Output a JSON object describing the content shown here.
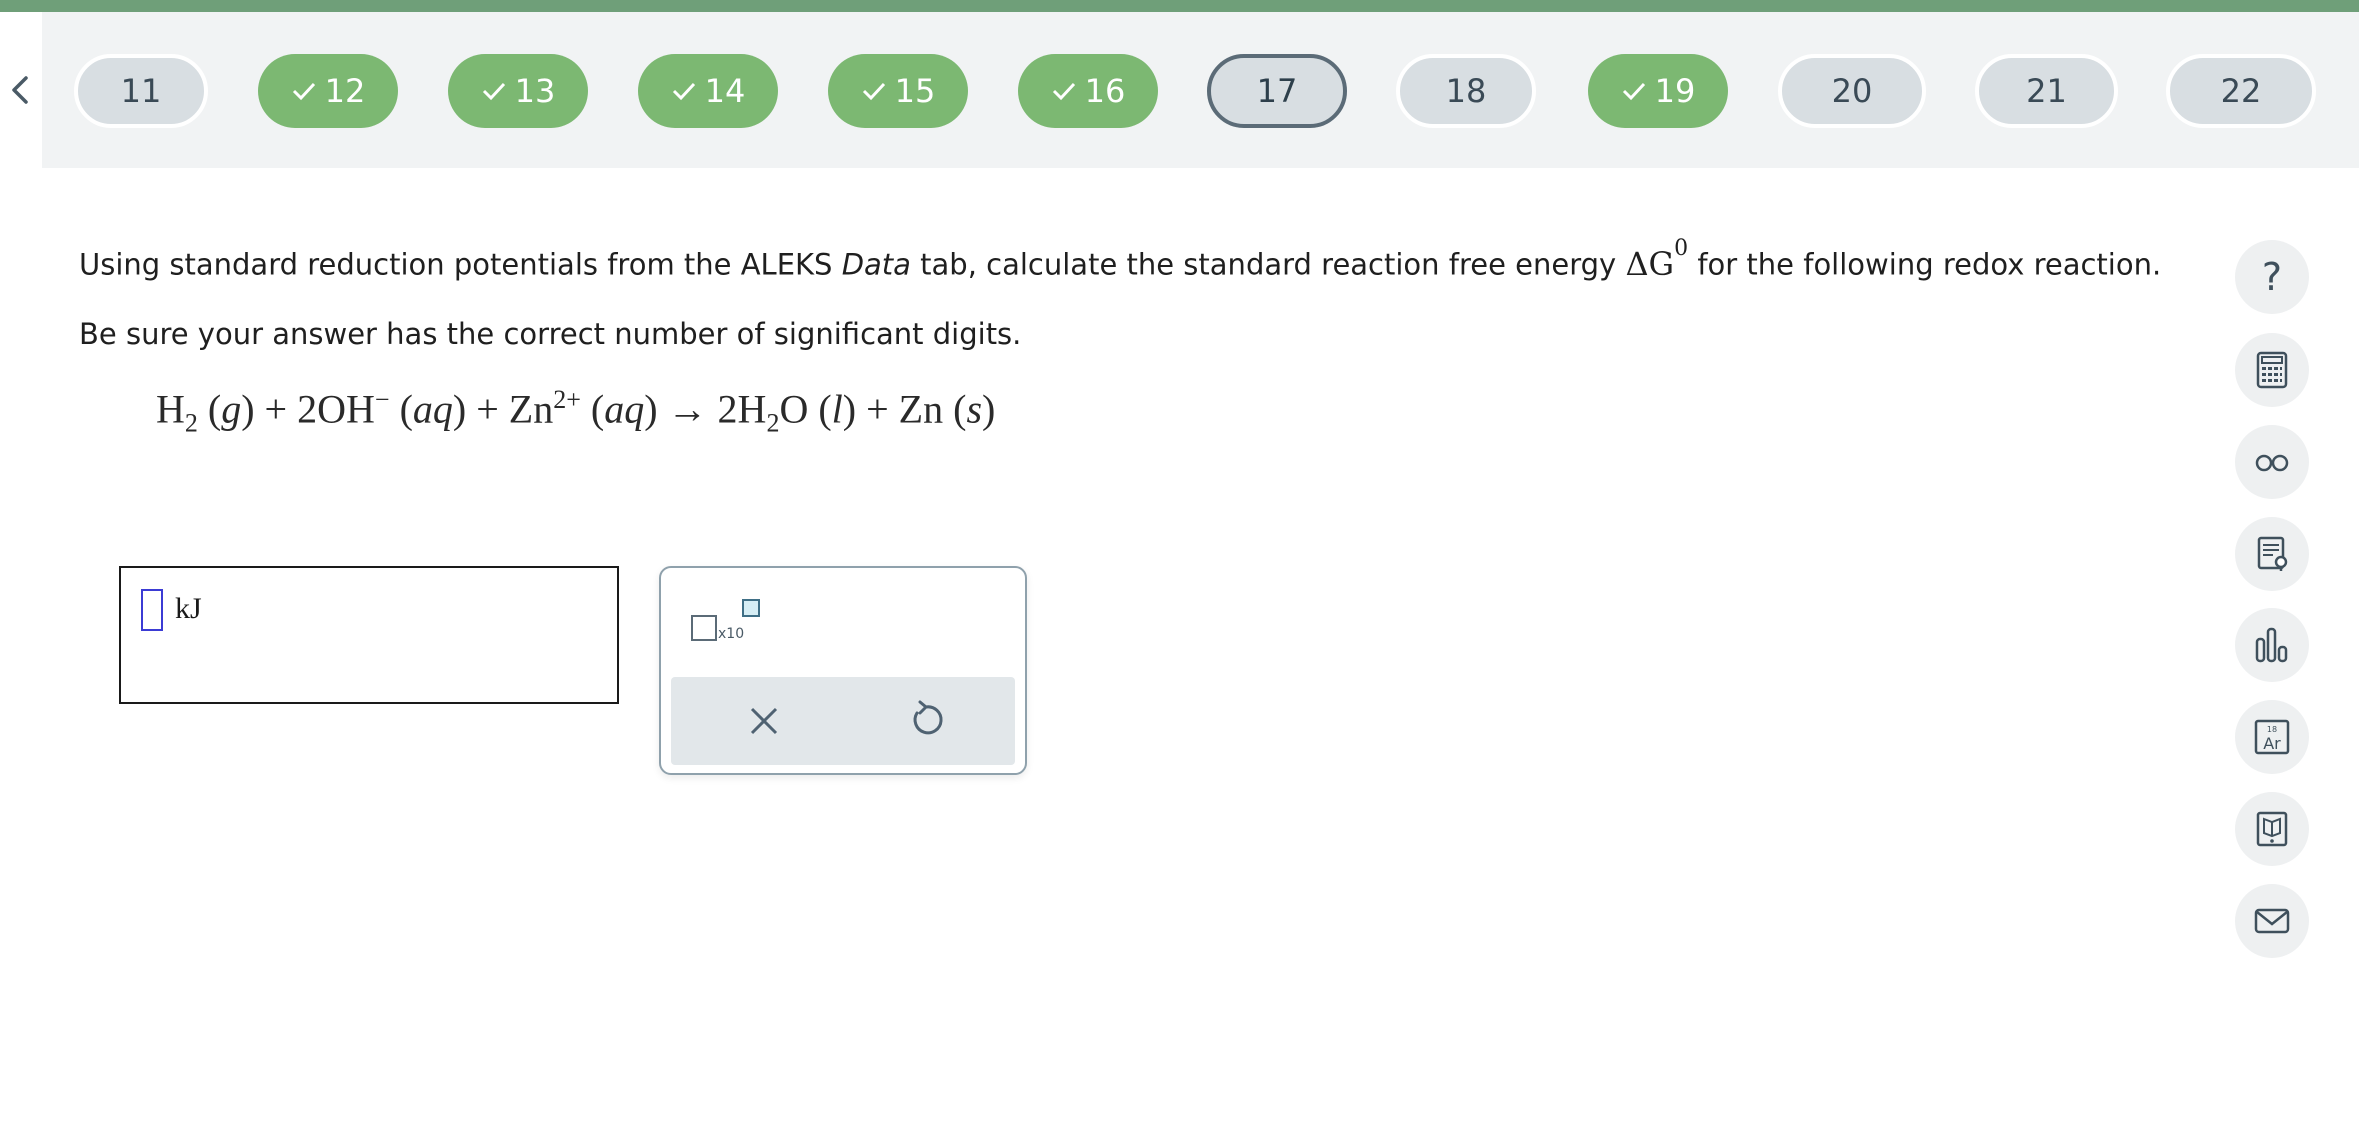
{
  "navigation": {
    "back_icon": "chevron-left-icon",
    "questions": [
      {
        "label": "11",
        "status": "unanswered"
      },
      {
        "label": "12",
        "status": "done"
      },
      {
        "label": "13",
        "status": "done"
      },
      {
        "label": "14",
        "status": "done"
      },
      {
        "label": "15",
        "status": "done"
      },
      {
        "label": "16",
        "status": "done"
      },
      {
        "label": "17",
        "status": "current"
      },
      {
        "label": "18",
        "status": "unanswered"
      },
      {
        "label": "19",
        "status": "done"
      },
      {
        "label": "20",
        "status": "unanswered"
      },
      {
        "label": "21",
        "status": "unanswered"
      },
      {
        "label": "22",
        "status": "unanswered"
      }
    ]
  },
  "question": {
    "text_before": "Using standard reduction potentials from the ALEKS ",
    "text_italic": "Data",
    "text_middle": " tab, calculate the standard reaction free energy ",
    "symbol_delta": "ΔG",
    "symbol_sup": "0",
    "text_after": " for the following redox reaction.",
    "instruction": "Be sure your answer has the correct number of significant digits."
  },
  "equation": {
    "h": "H",
    "sub2a": "2",
    "g": "g",
    "plus1": "+",
    "two_oh": "2OH",
    "minus": "−",
    "aq1": "aq",
    "plus2": "+",
    "zn": "Zn",
    "two_plus": "2+",
    "aq2": "aq",
    "arrow": "→",
    "two_h": "2H",
    "sub2b": "2",
    "o": "O",
    "l": "l",
    "plus3": "+",
    "zn_s": "Zn",
    "s": "s"
  },
  "answer": {
    "value": "",
    "unit": "kJ"
  },
  "tools": {
    "sci_notation_label": "x10",
    "clear_icon": "close-icon",
    "undo_icon": "undo-icon"
  },
  "sidebar": {
    "items": [
      {
        "name": "help",
        "glyph": "?"
      },
      {
        "name": "calculator-icon"
      },
      {
        "name": "glasses-icon"
      },
      {
        "name": "notes-icon"
      },
      {
        "name": "chart-icon"
      },
      {
        "name": "periodic-table-icon",
        "number": "18",
        "symbol": "Ar"
      },
      {
        "name": "book-icon"
      },
      {
        "name": "mail-icon"
      }
    ]
  },
  "colors": {
    "done": "#7cb872",
    "todo": "#d8dee2",
    "current_border": "#5b6b77",
    "top_strip": "#6f9f79"
  }
}
